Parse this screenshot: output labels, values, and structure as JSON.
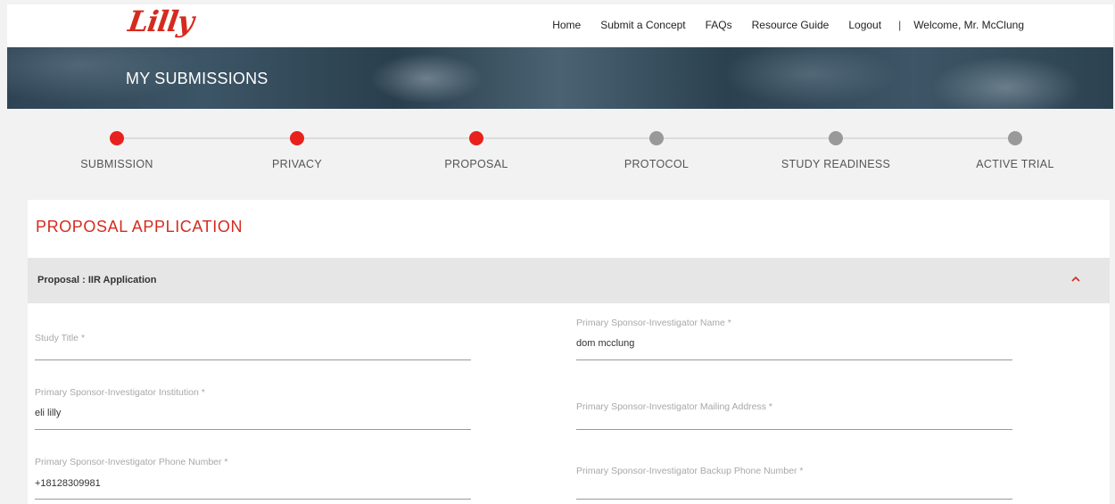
{
  "header": {
    "logo_text": "Lilly",
    "nav": [
      "Home",
      "Submit a Concept",
      "FAQs",
      "Resource Guide",
      "Logout"
    ],
    "separator": "|",
    "welcome": "Welcome, Mr. McClung"
  },
  "hero": {
    "title": "MY SUBMISSIONS"
  },
  "stepper": {
    "steps": [
      {
        "label": "SUBMISSION",
        "state": "complete"
      },
      {
        "label": "PRIVACY",
        "state": "complete"
      },
      {
        "label": "PROPOSAL",
        "state": "current"
      },
      {
        "label": "PROTOCOL",
        "state": "pending"
      },
      {
        "label": "STUDY READINESS",
        "state": "pending"
      },
      {
        "label": "ACTIVE TRIAL",
        "state": "pending"
      }
    ],
    "active_color": "#e8211d",
    "pending_color": "#999999"
  },
  "form": {
    "title": "PROPOSAL APPLICATION",
    "section": "Proposal : IIR Application",
    "fields": {
      "study_title": {
        "label": "Study Title *",
        "value": ""
      },
      "pi_name": {
        "label": "Primary Sponsor-Investigator Name *",
        "value": "dom mcclung"
      },
      "pi_institution": {
        "label": "Primary Sponsor-Investigator Institution *",
        "value": "eli lilly"
      },
      "pi_address": {
        "label": "Primary Sponsor-Investigator Mailing Address *",
        "value": ""
      },
      "pi_phone": {
        "label": "Primary Sponsor-Investigator Phone Number *",
        "value": "+18128309981"
      },
      "pi_backup_phone": {
        "label": "Primary Sponsor-Investigator Backup Phone Number *",
        "value": ""
      }
    }
  },
  "colors": {
    "brand_red": "#d52b1e"
  }
}
